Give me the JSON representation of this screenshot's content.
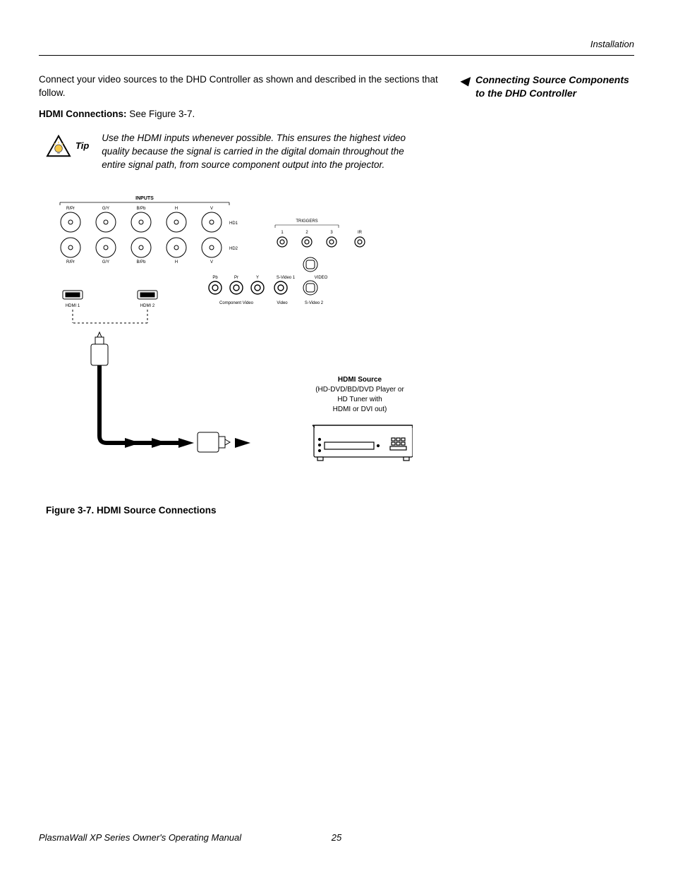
{
  "header": {
    "section_label": "Installation"
  },
  "body": {
    "intro_text": "Connect your video sources to the DHD Controller as shown and described in the sections that follow.",
    "hdmi_heading_bold": "HDMI Connections: ",
    "hdmi_heading_rest": "See Figure 3-7."
  },
  "side": {
    "arrow": "◀",
    "heading": "Connecting Source Components to the DHD Controller"
  },
  "tip": {
    "label": "Tip",
    "text": "Use the HDMI inputs whenever possible. This ensures the highest video quality because the signal is carried in the digital domain throughout the entire signal path, from source component output into the projector."
  },
  "figure": {
    "panel": {
      "inputs_label": "INPUTS",
      "top_row": [
        "R/Pr",
        "G/Y",
        "B/Pb",
        "H",
        "V"
      ],
      "bottom_row": [
        "R/Pr",
        "G/Y",
        "B/Pb",
        "H",
        "V"
      ],
      "hd1": "HD1",
      "hd2": "HD2",
      "hdmi1": "HDMI 1",
      "hdmi2": "HDMI 2",
      "triggers": "TRIGGERS",
      "trigger_nums": [
        "1",
        "2",
        "3"
      ],
      "ir": "IR",
      "comp_labels": [
        "Pb",
        "Pr",
        "Y"
      ],
      "svideo1": "S-Video 1",
      "video": "VIDEO",
      "component_video": "Component Video",
      "video_lbl": "Video",
      "svideo2": "S-Video 2"
    },
    "hdmi_source": {
      "title": "HDMI Source",
      "line1": "(HD-DVD/BD/DVD Player or",
      "line2": "HD Tuner with",
      "line3": "HDMI or DVI out)"
    },
    "caption": "Figure 3-7. HDMI Source Connections"
  },
  "footer": {
    "manual": "PlasmaWall XP Series Owner's Operating Manual",
    "page": "25"
  }
}
